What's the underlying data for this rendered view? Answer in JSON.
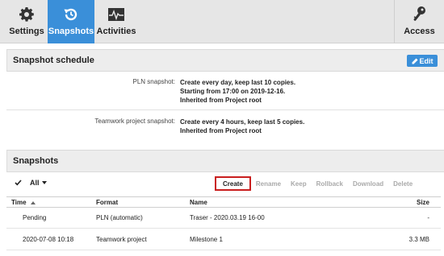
{
  "toolbar": {
    "items": [
      {
        "label": "Settings",
        "icon": "gear-icon",
        "active": false
      },
      {
        "label": "Snapshots",
        "icon": "snapshot-restore-icon",
        "active": true
      },
      {
        "label": "Activities",
        "icon": "activity-pulse-icon",
        "active": false
      }
    ],
    "access": {
      "label": "Access",
      "icon": "key-icon"
    }
  },
  "schedule": {
    "title": "Snapshot schedule",
    "edit_label": "Edit",
    "rows": [
      {
        "key": "PLN snapshot:",
        "lines": [
          "Create every day, keep last 10 copies.",
          "Starting from 17:00 on 2019-12-16.",
          "Inherited from Project root"
        ]
      },
      {
        "key": "Teamwork project snapshot:",
        "lines": [
          "Create every 4 hours, keep last 5 copies.",
          "Inherited from Project root"
        ]
      }
    ]
  },
  "snapshots": {
    "title": "Snapshots",
    "filter_label": "All",
    "actions": [
      "Create",
      "Rename",
      "Keep",
      "Rollback",
      "Download",
      "Delete"
    ],
    "columns": [
      "Time",
      "Format",
      "Name",
      "Size"
    ],
    "rows": [
      {
        "time": "Pending",
        "format": "PLN (automatic)",
        "name": "Traser - 2020.03.19 16-00",
        "size": "-"
      },
      {
        "time": "2020-07-08 10:18",
        "format": "Teamwork project",
        "name": "Milestone 1",
        "size": "3.3 MB"
      }
    ]
  },
  "colors": {
    "accent": "#3a8fd9",
    "highlight": "#c91e1e",
    "header_bg": "#e6e6e6"
  }
}
